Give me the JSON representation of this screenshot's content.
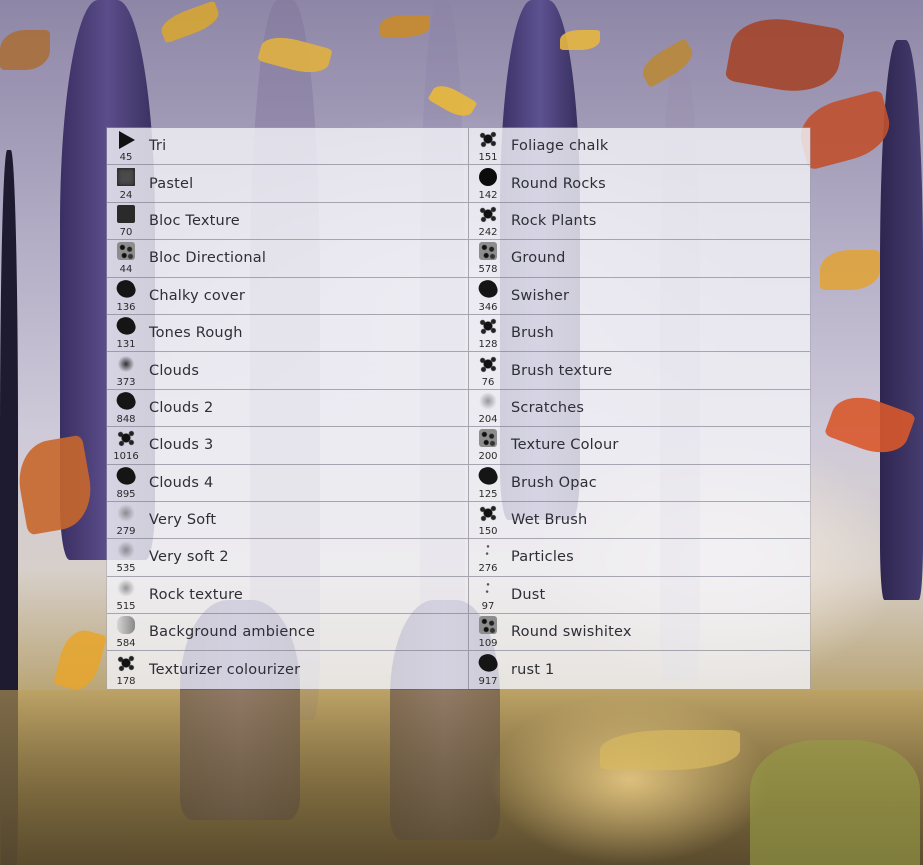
{
  "panel": {
    "title": "",
    "left_column": [
      {
        "name": "Tri",
        "size": "45",
        "icon": "triangle-brush-icon",
        "tip": "tri"
      },
      {
        "name": "Pastel",
        "size": "24",
        "icon": "pastel-brush-icon",
        "tip": "square-lt"
      },
      {
        "name": "Bloc Texture",
        "size": "70",
        "icon": "bloc-texture-brush-icon",
        "tip": "square"
      },
      {
        "name": "Bloc Directional",
        "size": "44",
        "icon": "bloc-directional-brush-icon",
        "tip": "speckle"
      },
      {
        "name": "Chalky cover",
        "size": "136",
        "icon": "chalky-cover-brush-icon",
        "tip": "blob"
      },
      {
        "name": "Tones Rough",
        "size": "131",
        "icon": "tones-rough-brush-icon",
        "tip": "blob"
      },
      {
        "name": "Clouds",
        "size": "373",
        "icon": "clouds-brush-icon",
        "tip": "soft"
      },
      {
        "name": "Clouds 2",
        "size": "848",
        "icon": "clouds-2-brush-icon",
        "tip": "blob"
      },
      {
        "name": "Clouds 3",
        "size": "1016",
        "icon": "clouds-3-brush-icon",
        "tip": "splat"
      },
      {
        "name": "Clouds 4",
        "size": "895",
        "icon": "clouds-4-brush-icon",
        "tip": "blob"
      },
      {
        "name": "Very Soft",
        "size": "279",
        "icon": "very-soft-brush-icon",
        "tip": "softer"
      },
      {
        "name": "Very soft 2",
        "size": "535",
        "icon": "very-soft-2-brush-icon",
        "tip": "softer"
      },
      {
        "name": "Rock texture",
        "size": "515",
        "icon": "rock-texture-brush-icon",
        "tip": "softer"
      },
      {
        "name": "Background ambience",
        "size": "584",
        "icon": "background-ambience-brush-icon",
        "tip": "fade"
      },
      {
        "name": "Texturizer colourizer",
        "size": "178",
        "icon": "texturizer-colourizer-brush-icon",
        "tip": "splat"
      }
    ],
    "right_column": [
      {
        "name": "Foliage chalk",
        "size": "151",
        "icon": "foliage-chalk-brush-icon",
        "tip": "splat"
      },
      {
        "name": "Round Rocks",
        "size": "142",
        "icon": "round-rocks-brush-icon",
        "tip": "round"
      },
      {
        "name": "Rock Plants",
        "size": "242",
        "icon": "rock-plants-brush-icon",
        "tip": "splat"
      },
      {
        "name": "Ground",
        "size": "578",
        "icon": "ground-brush-icon",
        "tip": "speckle"
      },
      {
        "name": "Swisher",
        "size": "346",
        "icon": "swisher-brush-icon",
        "tip": "blob"
      },
      {
        "name": "Brush",
        "size": "128",
        "icon": "brush-brush-icon",
        "tip": "splat"
      },
      {
        "name": "Brush texture",
        "size": "76",
        "icon": "brush-texture-brush-icon",
        "tip": "splat"
      },
      {
        "name": "Scratches",
        "size": "204",
        "icon": "scratches-brush-icon",
        "tip": "softer"
      },
      {
        "name": "Texture Colour",
        "size": "200",
        "icon": "texture-colour-brush-icon",
        "tip": "speckle"
      },
      {
        "name": "Brush Opac",
        "size": "125",
        "icon": "brush-opac-brush-icon",
        "tip": "blob"
      },
      {
        "name": "Wet Brush",
        "size": "150",
        "icon": "wet-brush-icon",
        "tip": "splat"
      },
      {
        "name": "Particles",
        "size": "276",
        "icon": "particles-brush-icon",
        "tip": "dots"
      },
      {
        "name": "Dust",
        "size": "97",
        "icon": "dust-brush-icon",
        "tip": "dots"
      },
      {
        "name": "Round swishitex",
        "size": "109",
        "icon": "round-swishitex-brush-icon",
        "tip": "speckle"
      },
      {
        "name": "rust 1",
        "size": "917",
        "icon": "rust-1-brush-icon",
        "tip": "blob"
      }
    ]
  },
  "colors": {
    "panel_bg": "#f2f1f6",
    "row_divider": "#6e6e7d",
    "label_text": "#2e2e36"
  }
}
